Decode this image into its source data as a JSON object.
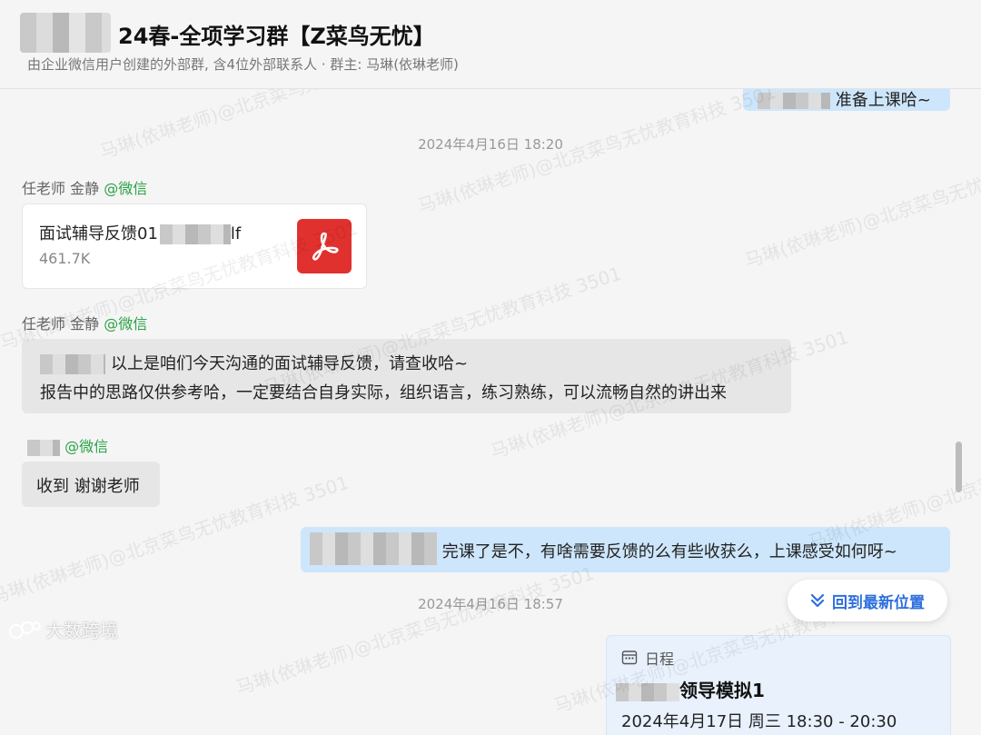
{
  "header": {
    "title": "24春-全项学习群【Z菜鸟无忧】",
    "subtitle": "由企业微信用户创建的外部群, 含4位外部联系人 · 群主: 马琳(依琳老师)"
  },
  "watermark_text": "马琳(依琳老师)@北京菜鸟无忧教育科技 3501",
  "messages": {
    "top_partial_right": "准备上课哈~",
    "timestamp_1": "2024年4月16日 18:20",
    "sender_teacher": "任老师 金静",
    "wechat_tag": "@微信",
    "file": {
      "name_start": "面试辅导反馈01",
      "name_end": "lf",
      "size": "461.7K"
    },
    "teacher_msg_line1": "以上是咱们今天沟通的面试辅导反馈，请查收哈~",
    "teacher_msg_line2": "报告中的思路仅供参考哈，一定要结合自身实际，组织语言，练习熟练，可以流畅自然的讲出来",
    "student_reply": "收到 谢谢老师",
    "right_msg": "完课了是不，有啥需要反馈的么有些收获么，上课感受如何呀~",
    "timestamp_2": "2024年4月16日 18:57",
    "schedule": {
      "label": "日程",
      "title": "领导模拟1",
      "time": "2024年4月17日 周三 18:30 - 20:30"
    }
  },
  "back_button_label": "回到最新位置",
  "brand_label": "大数跨境",
  "colors": {
    "wechat_green": "#2ba245",
    "bubble_self": "#cde6fb",
    "bubble_other": "#e6e6e6",
    "accent_blue": "#2f6fde",
    "pdf_red": "#e1312f"
  }
}
